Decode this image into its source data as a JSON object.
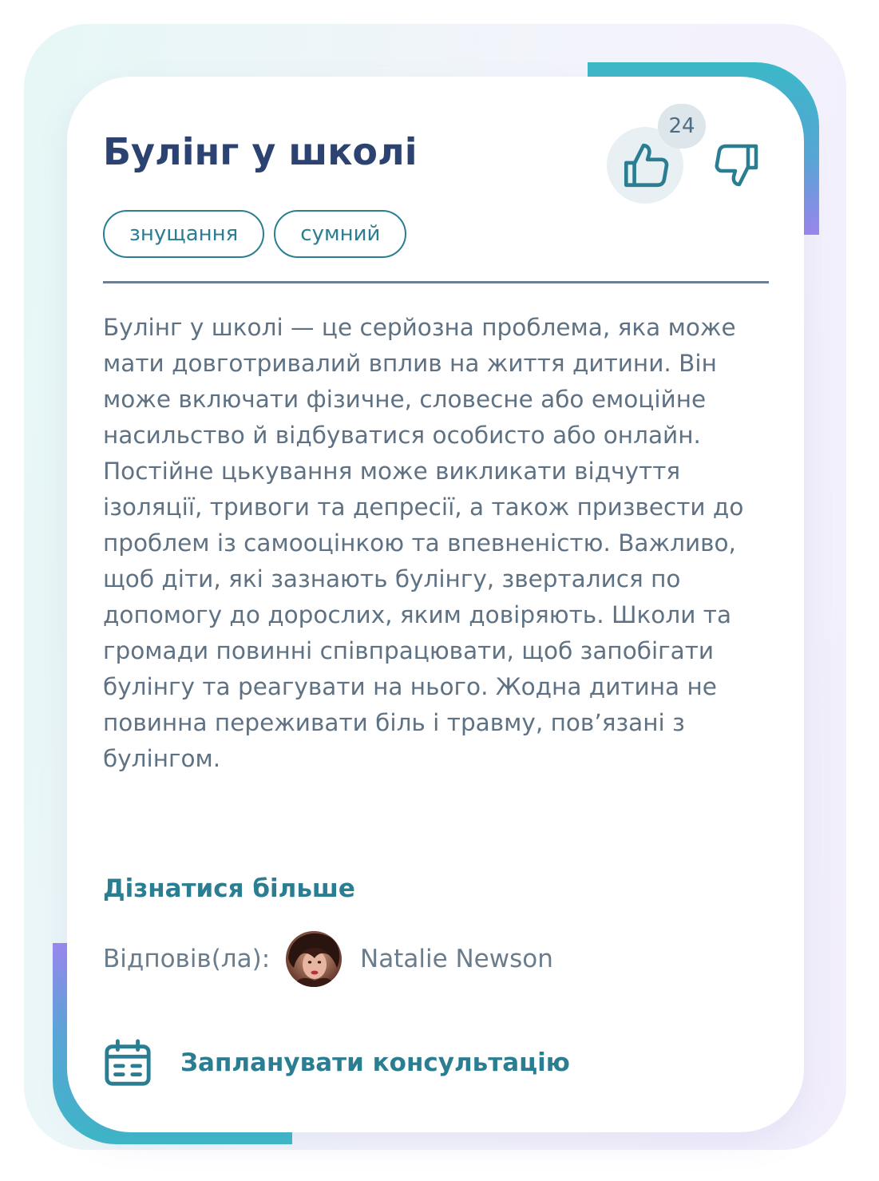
{
  "card": {
    "title": "Булінг у школі",
    "likes": {
      "count": "24",
      "like_icon": "thumbs-up-icon",
      "dislike_icon": "thumbs-down-icon"
    },
    "tags": [
      "знущання",
      "сумний"
    ],
    "description": "Булінг у школі — це серйозна проблема, яка може мати довготривалий вплив на життя дитини. Він може включати фізичне, словесне або емоційне насильство й відбуватися особисто або онлайн. Постійне цькування може викликати відчуття ізоляції, тривоги та депресії, а також призвести до проблем із самооцінкою та впевненістю. Важливо, щоб діти, які зазнають булінгу, зверталися по допомогу до дорослих, яким довіряють. Школи та громади повинні співпрацювати, щоб запобігати булінгу та реагувати на нього. Жодна дитина не повинна переживати біль і травму, пов’язані з булінгом.",
    "learn_more": "Дізнатися більше",
    "answered_by_label": "Відповів(ла):",
    "author_name": "Natalie Newson",
    "schedule_label": "Запланувати консультацію",
    "schedule_icon": "calendar-icon"
  },
  "colors": {
    "title": "#2c4270",
    "accent": "#2b7e92",
    "body_text": "#5f7284",
    "gradient_teal": "#3bb9c7",
    "gradient_purple": "#9b86ee"
  }
}
